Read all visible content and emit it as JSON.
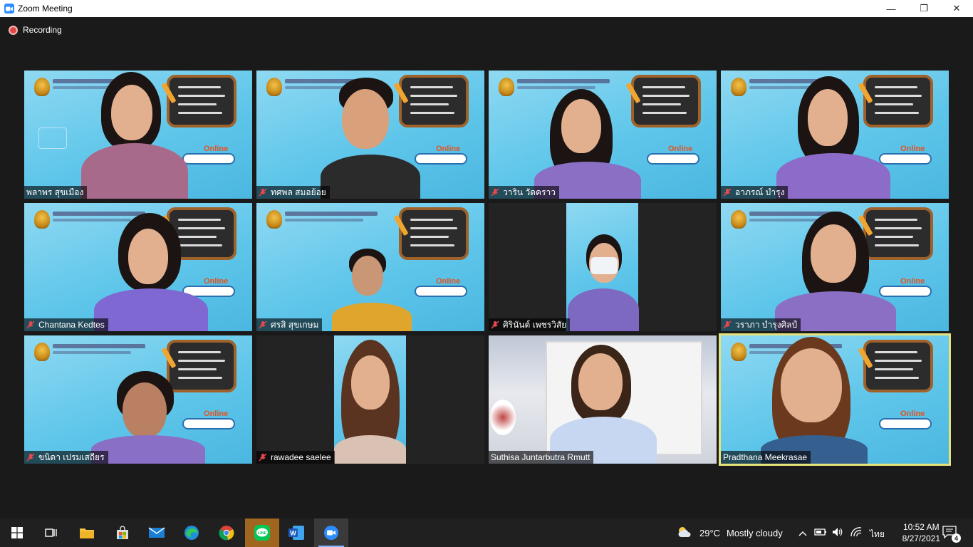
{
  "window": {
    "title": "Zoom Meeting",
    "controls": {
      "minimize": "—",
      "maximize": "❐",
      "close": "✕"
    }
  },
  "recording": {
    "label": "Recording",
    "color": "#e04848"
  },
  "accent": {
    "zoom_blue": "#2d8cff",
    "active_speaker_border": "#e6e27a"
  },
  "participants": [
    {
      "name": "พลาพร สุขเมือง",
      "muted": false,
      "background": "virtual-banner"
    },
    {
      "name": "ทศพล สมอย้อย",
      "muted": true,
      "background": "virtual-banner"
    },
    {
      "name": "วาริน วัดคราว",
      "muted": true,
      "background": "virtual-banner"
    },
    {
      "name": "อาภรณ์ บำรุง",
      "muted": true,
      "background": "virtual-banner"
    },
    {
      "name": "Chantana Kedtes",
      "muted": true,
      "background": "virtual-banner"
    },
    {
      "name": "ศรสิ สุขเกษม",
      "muted": true,
      "background": "virtual-banner"
    },
    {
      "name": "ศิรินันต์ เพชรวิสัย",
      "muted": true,
      "background": "portrait-video"
    },
    {
      "name": "วราภา บำรุงศิลป์",
      "muted": true,
      "background": "virtual-banner"
    },
    {
      "name": "ขนิดา เปรมเสถียร",
      "muted": true,
      "background": "virtual-banner"
    },
    {
      "name": "rawadee saelee",
      "muted": true,
      "background": "portrait-video"
    },
    {
      "name": "Suthisa  Juntarbutra Rmutt",
      "muted": false,
      "background": "room"
    },
    {
      "name": "Pradthana Meekrasae",
      "muted": false,
      "background": "virtual-banner",
      "active_speaker": true
    }
  ],
  "banner_text": {
    "online": "Online"
  },
  "taskbar": {
    "apps": [
      "windows-start-icon",
      "task-view-icon",
      "file-explorer-icon",
      "microsoft-store-icon",
      "mail-icon",
      "edge-icon",
      "chrome-icon",
      "line-icon",
      "word-icon",
      "zoom-icon"
    ],
    "weather": {
      "temp": "29°C",
      "condition": "Mostly cloudy"
    },
    "language": "ไทย",
    "time": "10:52 AM",
    "date": "8/27/2021",
    "notifications": "4"
  }
}
